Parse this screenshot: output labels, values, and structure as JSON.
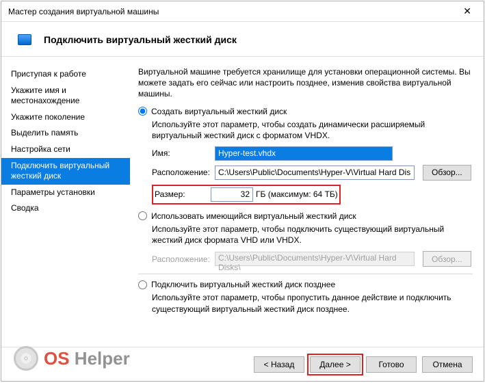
{
  "window": {
    "title": "Мастер создания виртуальной машины"
  },
  "header": {
    "title": "Подключить виртуальный жесткий диск"
  },
  "sidebar": {
    "items": [
      {
        "label": "Приступая к работе"
      },
      {
        "label": "Укажите имя и местонахождение"
      },
      {
        "label": "Укажите поколение"
      },
      {
        "label": "Выделить память"
      },
      {
        "label": "Настройка сети"
      },
      {
        "label": "Подключить виртуальный жесткий диск"
      },
      {
        "label": "Параметры установки"
      },
      {
        "label": "Сводка"
      }
    ]
  },
  "main": {
    "intro": "Виртуальной машине требуется хранилище для установки операционной системы. Вы можете задать его сейчас или настроить позднее, изменив свойства виртуальной машины.",
    "opt1": {
      "label": "Создать виртуальный жесткий диск",
      "desc": "Используйте этот параметр, чтобы создать динамически расширяемый виртуальный жесткий диск с форматом VHDX.",
      "name_label": "Имя:",
      "name_value": "Hyper-test.vhdx",
      "loc_label": "Расположение:",
      "loc_value": "C:\\Users\\Public\\Documents\\Hyper-V\\Virtual Hard Disks\\",
      "browse": "Обзор...",
      "size_label": "Размер:",
      "size_value": "32",
      "size_unit": "ГБ (максимум: 64 ТБ)"
    },
    "opt2": {
      "label": "Использовать имеющийся виртуальный жесткий диск",
      "desc": "Используйте этот параметр, чтобы подключить существующий виртуальный жесткий диск формата VHD или VHDX.",
      "loc_label": "Расположение:",
      "loc_value": "C:\\Users\\Public\\Documents\\Hyper-V\\Virtual Hard Disks\\",
      "browse": "Обзор..."
    },
    "opt3": {
      "label": "Подключить виртуальный жесткий диск позднее",
      "desc": "Используйте этот параметр, чтобы пропустить данное действие и подключить существующий виртуальный жесткий диск позднее."
    }
  },
  "footer": {
    "back": "< Назад",
    "next": "Далее >",
    "finish": "Готово",
    "cancel": "Отмена"
  },
  "watermark": {
    "os": "OS",
    "helper": " Helper"
  }
}
